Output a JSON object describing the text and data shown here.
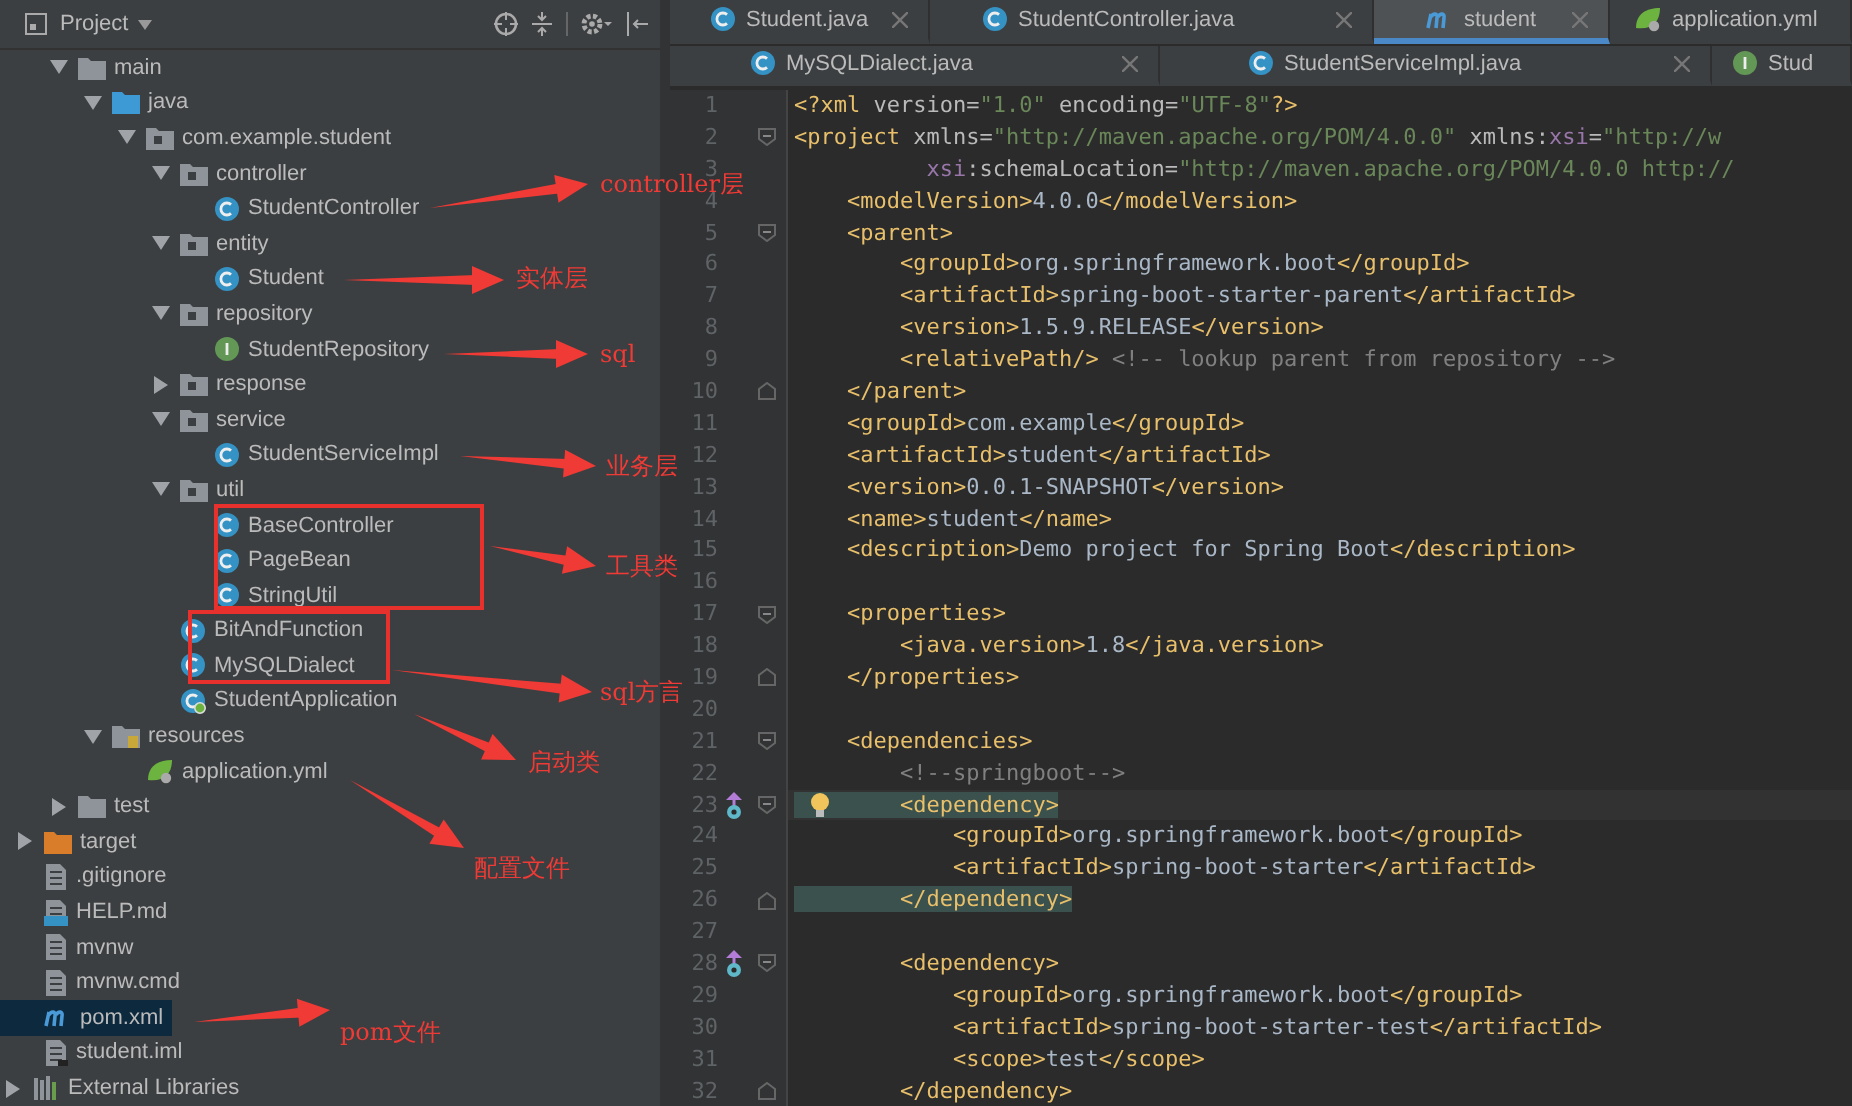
{
  "project_panel": {
    "title": "Project"
  },
  "tree": [
    {
      "children": [
        {
          "children": [
            {
              "label": "main",
              "kind": "folder",
              "expanded": true,
              "selected": false,
              "children": [
                {
                  "label": "java",
                  "kind": "src-folder",
                  "expanded": true,
                  "selected": false,
                  "children": [
                    {
                      "label": "com.example.student",
                      "kind": "package",
                      "expanded": true,
                      "selected": false,
                      "children": [
                        {
                          "label": "controller",
                          "kind": "package",
                          "expanded": true,
                          "selected": false,
                          "children": [
                            {
                              "label": "StudentController",
                              "kind": "class",
                              "selected": false
                            }
                          ]
                        },
                        {
                          "label": "entity",
                          "kind": "package",
                          "expanded": true,
                          "selected": false,
                          "children": [
                            {
                              "label": "Student",
                              "kind": "class",
                              "selected": false
                            }
                          ]
                        },
                        {
                          "label": "repository",
                          "kind": "package",
                          "expanded": true,
                          "selected": false,
                          "children": [
                            {
                              "label": "StudentRepository",
                              "kind": "interface",
                              "selected": false
                            }
                          ]
                        },
                        {
                          "label": "response",
                          "kind": "package",
                          "expanded": false,
                          "selected": false
                        },
                        {
                          "label": "service",
                          "kind": "package",
                          "expanded": true,
                          "selected": false,
                          "children": [
                            {
                              "label": "StudentServiceImpl",
                              "kind": "class",
                              "selected": false
                            }
                          ]
                        },
                        {
                          "label": "util",
                          "kind": "package",
                          "expanded": true,
                          "selected": false,
                          "children": [
                            {
                              "label": "BaseController",
                              "kind": "class",
                              "selected": false
                            },
                            {
                              "label": "PageBean",
                              "kind": "class",
                              "selected": false
                            },
                            {
                              "label": "StringUtil",
                              "kind": "class",
                              "selected": false
                            }
                          ]
                        },
                        {
                          "label": "BitAndFunction",
                          "kind": "class",
                          "selected": false
                        },
                        {
                          "label": "MySQLDialect",
                          "kind": "class",
                          "selected": false
                        },
                        {
                          "label": "StudentApplication",
                          "kind": "spring-class",
                          "selected": false
                        }
                      ]
                    }
                  ]
                },
                {
                  "label": "resources",
                  "kind": "resources",
                  "expanded": true,
                  "selected": false,
                  "children": [
                    {
                      "label": "application.yml",
                      "kind": "yml",
                      "selected": false
                    }
                  ]
                }
              ]
            },
            {
              "label": "test",
              "kind": "folder",
              "expanded": false,
              "selected": false
            }
          ]
        },
        {
          "label": "target",
          "kind": "excluded-folder",
          "expanded": false,
          "selected": false
        },
        {
          "label": ".gitignore",
          "kind": "text-file",
          "selected": false
        },
        {
          "label": "HELP.md",
          "kind": "md-file",
          "selected": false
        },
        {
          "label": "mvnw",
          "kind": "text-file",
          "selected": false
        },
        {
          "label": "mvnw.cmd",
          "kind": "text-file",
          "selected": false
        },
        {
          "label": "pom.xml",
          "kind": "maven",
          "selected": true
        },
        {
          "label": "student.iml",
          "kind": "iml",
          "selected": false
        }
      ]
    },
    {
      "label": "External Libraries",
      "kind": "libraries",
      "expanded": false,
      "selected": false
    }
  ],
  "tab_rows": [
    [
      {
        "label": "Student.java",
        "kind": "class",
        "selected": false,
        "closable": true
      },
      {
        "label": "StudentController.java",
        "kind": "class",
        "selected": false,
        "closable": true
      },
      {
        "label": "student",
        "kind": "maven",
        "selected": true,
        "closable": true
      },
      {
        "label": "application.yml",
        "kind": "yml",
        "selected": false,
        "closable": false
      }
    ],
    [
      {
        "label": "MySQLDialect.java",
        "kind": "class",
        "selected": false,
        "closable": true
      },
      {
        "label": "StudentServiceImpl.java",
        "kind": "class",
        "selected": false,
        "closable": true
      },
      {
        "label": "Stud",
        "kind": "interface",
        "selected": false,
        "closable": false
      }
    ]
  ],
  "code_lines": [
    {
      "number": "1",
      "tokens": [
        {
          "kind": "tag",
          "text": "<?xml "
        },
        {
          "kind": "attr",
          "text": "version="
        },
        {
          "kind": "str",
          "text": "\"1.0\""
        },
        {
          "kind": "attr",
          "text": " encoding="
        },
        {
          "kind": "str",
          "text": "\"UTF-8\""
        },
        {
          "kind": "tag",
          "text": "?>"
        }
      ]
    },
    {
      "number": "2",
      "fold_start": true,
      "tokens": [
        {
          "kind": "tag",
          "text": "<project "
        },
        {
          "kind": "attr",
          "text": "xmlns="
        },
        {
          "kind": "str",
          "text": "\"http://maven.apache.org/POM/4.0.0\""
        },
        {
          "kind": "attr",
          "text": " xmlns:"
        },
        {
          "kind": "ns",
          "text": "xsi"
        },
        {
          "kind": "attr",
          "text": "="
        },
        {
          "kind": "str",
          "text": "\"http://w"
        }
      ]
    },
    {
      "number": "3",
      "tokens": [
        {
          "kind": "ns",
          "text": "          xsi"
        },
        {
          "kind": "attr",
          "text": ":schemaLocation="
        },
        {
          "kind": "str",
          "text": "\"http://maven.apache.org/POM/4.0.0 http://"
        }
      ]
    },
    {
      "number": "4",
      "tokens": [
        {
          "kind": "tag",
          "text": "    <modelVersion>"
        },
        {
          "kind": "text",
          "text": "4.0.0"
        },
        {
          "kind": "tag",
          "text": "</modelVersion>"
        }
      ]
    },
    {
      "number": "5",
      "fold_start": true,
      "tokens": [
        {
          "kind": "tag",
          "text": "    <parent>"
        }
      ]
    },
    {
      "number": "6",
      "tokens": [
        {
          "kind": "tag",
          "text": "        <groupId>"
        },
        {
          "kind": "text",
          "text": "org.springframework.boot"
        },
        {
          "kind": "tag",
          "text": "</groupId>"
        }
      ]
    },
    {
      "number": "7",
      "tokens": [
        {
          "kind": "tag",
          "text": "        <artifactId>"
        },
        {
          "kind": "text",
          "text": "spring-boot-starter-parent"
        },
        {
          "kind": "tag",
          "text": "</artifactId>"
        }
      ]
    },
    {
      "number": "8",
      "tokens": [
        {
          "kind": "tag",
          "text": "        <version>"
        },
        {
          "kind": "text",
          "text": "1.5.9.RELEASE"
        },
        {
          "kind": "tag",
          "text": "</version>"
        }
      ]
    },
    {
      "number": "9",
      "tokens": [
        {
          "kind": "tag",
          "text": "        <relativePath/>"
        },
        {
          "kind": "comment",
          "text": " <!-- lookup parent from repository -->"
        }
      ]
    },
    {
      "number": "10",
      "fold_end": true,
      "tokens": [
        {
          "kind": "tag",
          "text": "    </parent>"
        }
      ]
    },
    {
      "number": "11",
      "tokens": [
        {
          "kind": "tag",
          "text": "    <groupId>"
        },
        {
          "kind": "text",
          "text": "com.example"
        },
        {
          "kind": "tag",
          "text": "</groupId>"
        }
      ]
    },
    {
      "number": "12",
      "tokens": [
        {
          "kind": "tag",
          "text": "    <artifactId>"
        },
        {
          "kind": "text",
          "text": "student"
        },
        {
          "kind": "tag",
          "text": "</artifactId>"
        }
      ]
    },
    {
      "number": "13",
      "tokens": [
        {
          "kind": "tag",
          "text": "    <version>"
        },
        {
          "kind": "text",
          "text": "0.0.1-SNAPSHOT"
        },
        {
          "kind": "tag",
          "text": "</version>"
        }
      ]
    },
    {
      "number": "14",
      "tokens": [
        {
          "kind": "tag",
          "text": "    <name>"
        },
        {
          "kind": "text",
          "text": "student"
        },
        {
          "kind": "tag",
          "text": "</name>"
        }
      ]
    },
    {
      "number": "15",
      "tokens": [
        {
          "kind": "tag",
          "text": "    <description>"
        },
        {
          "kind": "text",
          "text": "Demo project for Spring Boot"
        },
        {
          "kind": "tag",
          "text": "</description>"
        }
      ]
    },
    {
      "number": "16"
    },
    {
      "number": "17",
      "fold_start": true,
      "tokens": [
        {
          "kind": "tag",
          "text": "    <properties>"
        }
      ]
    },
    {
      "number": "18",
      "tokens": [
        {
          "kind": "tag",
          "text": "        <java.version>"
        },
        {
          "kind": "text",
          "text": "1.8"
        },
        {
          "kind": "tag",
          "text": "</java.version>"
        }
      ]
    },
    {
      "number": "19",
      "fold_end": true,
      "tokens": [
        {
          "kind": "tag",
          "text": "    </properties>"
        }
      ]
    },
    {
      "number": "20"
    },
    {
      "number": "21",
      "fold_start": true,
      "tokens": [
        {
          "kind": "tag",
          "text": "    <dependencies>"
        }
      ]
    },
    {
      "number": "22",
      "tokens": [
        {
          "kind": "comment",
          "text": "        <!--springboot-->"
        }
      ]
    },
    {
      "number": "23",
      "fold_start": true,
      "current": true,
      "marker": true,
      "bulb": true,
      "tokens": [
        {
          "kind": "match",
          "text": "        <dependency>"
        }
      ]
    },
    {
      "number": "24",
      "tokens": [
        {
          "kind": "tag",
          "text": "            <groupId>"
        },
        {
          "kind": "text",
          "text": "org.springframework.boot"
        },
        {
          "kind": "tag",
          "text": "</groupId>"
        }
      ]
    },
    {
      "number": "25",
      "tokens": [
        {
          "kind": "tag",
          "text": "            <artifactId>"
        },
        {
          "kind": "text",
          "text": "spring-boot-starter"
        },
        {
          "kind": "tag",
          "text": "</artifactId>"
        }
      ]
    },
    {
      "number": "26",
      "fold_end": true,
      "tokens": [
        {
          "kind": "match",
          "text": "        </dependency>"
        }
      ]
    },
    {
      "number": "27"
    },
    {
      "number": "28",
      "fold_start": true,
      "marker": true,
      "tokens": [
        {
          "kind": "tag",
          "text": "        <dependency>"
        }
      ]
    },
    {
      "number": "29",
      "tokens": [
        {
          "kind": "tag",
          "text": "            <groupId>"
        },
        {
          "kind": "text",
          "text": "org.springframework.boot"
        },
        {
          "kind": "tag",
          "text": "</groupId>"
        }
      ]
    },
    {
      "number": "30",
      "tokens": [
        {
          "kind": "tag",
          "text": "            <artifactId>"
        },
        {
          "kind": "text",
          "text": "spring-boot-starter-test"
        },
        {
          "kind": "tag",
          "text": "</artifactId>"
        }
      ]
    },
    {
      "number": "31",
      "tokens": [
        {
          "kind": "tag",
          "text": "            <scope>"
        },
        {
          "kind": "text",
          "text": "test"
        },
        {
          "kind": "tag",
          "text": "</scope>"
        }
      ]
    },
    {
      "number": "32",
      "fold_end": true,
      "tokens": [
        {
          "kind": "tag",
          "text": "        </dependency>"
        }
      ]
    }
  ],
  "annotations": [
    {
      "label": "controller层"
    },
    {
      "label": "实体层"
    },
    {
      "label": "sql"
    },
    {
      "label": "业务层"
    },
    {
      "label": "工具类"
    },
    {
      "label": "sql方言"
    },
    {
      "label": "启动类"
    },
    {
      "label": "配置文件"
    },
    {
      "label": "pom文件"
    }
  ]
}
